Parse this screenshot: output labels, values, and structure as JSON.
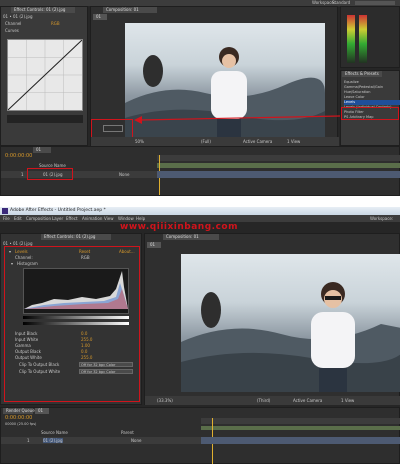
{
  "shot1": {
    "menu": {
      "workspace_label": "Workspace:",
      "workspace_value": "Standard"
    },
    "effect_controls": {
      "tab": "Effect Controls: 01 (2).jpg",
      "layer": "01 • 01 (2).jpg",
      "channel_label": "Channel",
      "channel_value": "RGB",
      "curves_label": "Curves"
    },
    "composition": {
      "tab": "Composition: 01",
      "sub_tab": "01",
      "zoom": "50%",
      "res": "(Full)",
      "view": "Active Camera",
      "views": "1 View"
    },
    "effects_presets": {
      "title": "Effects & Presets",
      "items": [
        "Equalize",
        "Gamma/Pedestal/Gain",
        "Hue/Saturation",
        "Leave Color",
        "Levels",
        "Levels (Individual Controls)",
        "Photo Filter",
        "PS Arbitrary Map"
      ],
      "highlighted": "Levels"
    },
    "timeline": {
      "tab": "01",
      "timecode": "0:00:00:00",
      "source_name_header": "Source Name",
      "layer_number": "1",
      "layer_name": "01 (2).jpg",
      "mode": "None"
    }
  },
  "shot2": {
    "title": "Adobe After Effects - Untitled Project.aep *",
    "menu": [
      "File",
      "Edit",
      "Composition",
      "Layer",
      "Effect",
      "Animation",
      "View",
      "Window",
      "Help"
    ],
    "watermark": "www.qiiixinbang.com",
    "workspace_label": "Workspace:",
    "effect_controls": {
      "tab": "Effect Controls: 01 (2).jpg",
      "layer": "01 • 01 (2).jpg",
      "effect_name": "Levels",
      "reset": "Reset",
      "about": "About...",
      "channel_label": "Channel:",
      "channel_value": "RGB",
      "histogram_label": "Histogram",
      "rows": [
        {
          "label": "Input Black",
          "value": "0.0"
        },
        {
          "label": "Input White",
          "value": "255.0"
        },
        {
          "label": "Gamma",
          "value": "1.00"
        },
        {
          "label": "Output Black",
          "value": "0.0"
        },
        {
          "label": "Output White",
          "value": "255.0"
        }
      ],
      "clip_black_label": "Clip To Output Black",
      "clip_black_value": "Off for 32 bpc Color",
      "clip_white_label": "Clip To Output White",
      "clip_white_value": "Off for 32 bpc Color"
    },
    "composition": {
      "tab": "Composition: 01",
      "sub_tab": "01",
      "zoom": "(33.3%)",
      "res": "(Third)",
      "view": "Active Camera",
      "views": "1 View"
    },
    "timeline": {
      "tab": "Render Queue",
      "sub_tab": "01",
      "timecode": "0:00:00:00",
      "fps": "00000 (25.00 fps)",
      "source_name_header": "Source Name",
      "parent_header": "Parent",
      "layer_number": "1",
      "layer_name": "01 (2).jpg",
      "mode": "None"
    }
  },
  "colors": {
    "accent_red": "#d0141c",
    "orange": "#d99a2b",
    "panel": "#3a3a3a",
    "dark": "#232323",
    "timeline_bar": "#5a6e4a"
  }
}
